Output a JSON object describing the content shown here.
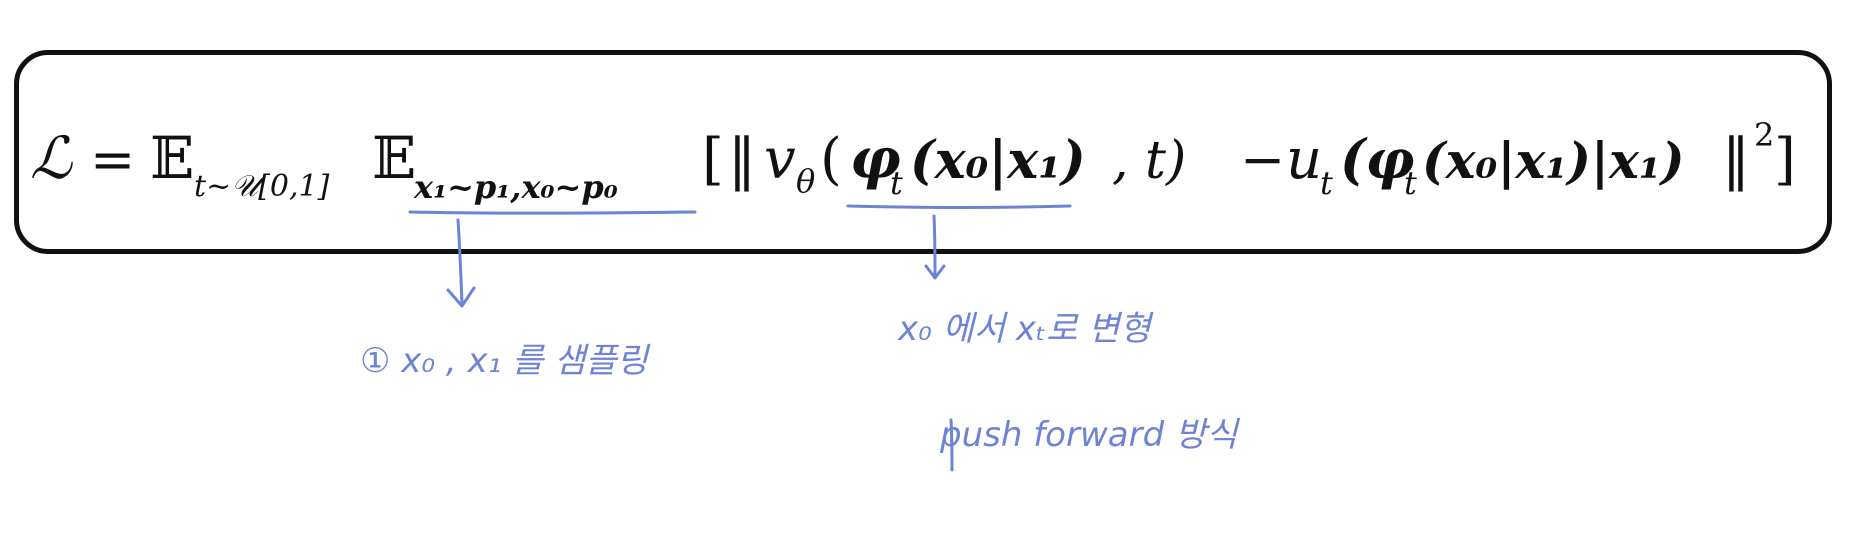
{
  "formula": {
    "lhs": "ℒ",
    "equals": "=",
    "expect1": "𝔼",
    "expect1_sub": "t~𝒰[0,1]",
    "expect2": "𝔼",
    "expect2_sub": "x₁~p₁,x₀~p₀",
    "open_bracket": "[",
    "norm_open": "‖",
    "v_theta": "v",
    "theta_sub": "θ",
    "lparen1": "(",
    "phi_term": "φ",
    "phi_sub": "t",
    "phi_args": "(x₀|x₁)",
    "comma_t": ", t)",
    "minus": "−",
    "u_term": "u",
    "u_sub": "t",
    "u_args": "(φ",
    "u_phi_sub": "t",
    "u_args_rest": "(x₀|x₁)|x₁)",
    "norm_close": "‖",
    "power": "2",
    "close_bracket": "]"
  },
  "annotations": {
    "left_note": "① x₀ , x₁ 를 샘플링",
    "right_note_line1": "x₀ 에서 xₜ로 변형",
    "right_note_line2": "push forward 방식"
  },
  "colors": {
    "ink": "#6f83d6",
    "text": "#111111",
    "border": "#111111",
    "background": "#ffffff"
  }
}
